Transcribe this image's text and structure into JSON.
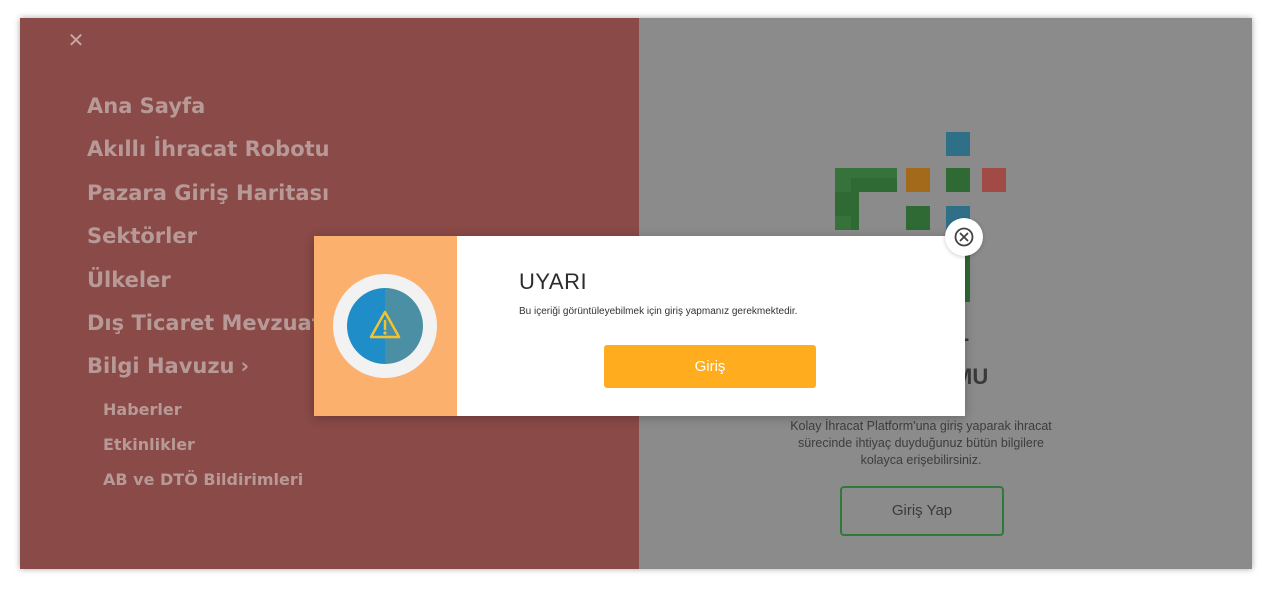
{
  "menu": {
    "close_icon": "close-icon",
    "items": [
      "Ana Sayfa",
      "Akıllı İhracat Robotu",
      "Pazara Giriş Haritası",
      "Sektörler",
      "Ülkeler",
      "Dış Ticaret Mevzuatı"
    ],
    "bilgi_havuzu": {
      "label": "Bilgi Havuzu",
      "chevron": "›",
      "subitems": [
        "Haberler",
        "Etkinlikler",
        "AB ve DTÖ Bildirimleri"
      ]
    }
  },
  "right_panel": {
    "title_line1": "İHRACAT",
    "title_line2": "PLATFORMU",
    "description": "Kolay İhracat Platform'una giriş yaparak ihracat sürecinde ihtiyaç duyduğunuz bütün bilgilere kolayca erişebilirsiniz.",
    "login_button": "Giriş Yap"
  },
  "modal": {
    "title": "UYARI",
    "message": "Bu içeriği görüntüleyebilmek için giriş yapmanız gerekmektedir.",
    "button": "Giriş",
    "icon": "warning-icon"
  },
  "colors": {
    "menu_bg": "#8a4a47",
    "overlay_bg": "#8b8b8b",
    "modal_side": "#fcb06e",
    "modal_button": "#ffad1f",
    "logo_green": "#2f7a3a",
    "logo_orange": "#d27e12",
    "logo_teal": "#3a8fa8",
    "logo_red": "#b04f4a"
  }
}
